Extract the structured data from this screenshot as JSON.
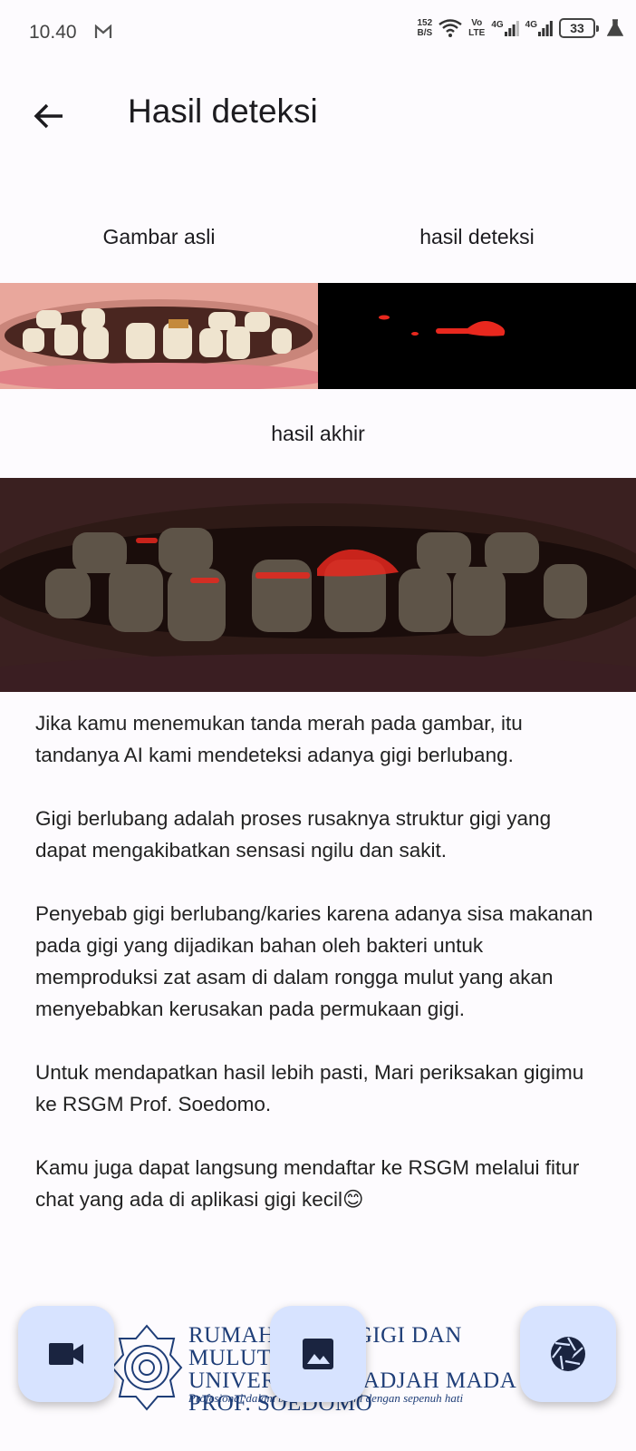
{
  "status": {
    "time": "10.40",
    "net_speed_value": "152",
    "net_speed_unit": "B/S",
    "volte_top": "Vo",
    "volte_bottom": "LTE",
    "sig1_label": "4G",
    "sig2_label": "4G",
    "battery": "33"
  },
  "appbar": {
    "title": "Hasil deteksi"
  },
  "images": {
    "original_label": "Gambar asli",
    "detection_label": "hasil deteksi",
    "final_label": "hasil akhir"
  },
  "content": {
    "paragraphs": [
      "Jika kamu menemukan tanda merah pada gambar, itu tandanya AI kami mendeteksi adanya gigi berlubang.",
      "Gigi berlubang adalah proses rusaknya struktur gigi yang dapat mengakibatkan sensasi ngilu dan sakit.",
      "Penyebab gigi berlubang/karies karena adanya sisa makanan pada gigi yang dijadikan bahan oleh bakteri untuk memproduksi zat asam di dalam rongga mulut yang akan menyebabkan kerusakan pada permukaan gigi.",
      "Untuk mendapatkan hasil lebih pasti, Mari periksakan gigimu ke RSGM Prof. Soedomo.",
      "Kamu juga dapat langsung mendaftar ke RSGM melalui fitur chat yang ada di aplikasi gigi kecil😊"
    ]
  },
  "logo": {
    "line1": "RUMAH SAKIT GIGI DAN MULUT",
    "line2": "UNIVERSITAS GADJAH MADA",
    "line3": "PROF. SOEDOMO",
    "tagline": "Profesional dalam bekerja, melayani dengan sepenuh hati"
  },
  "colors": {
    "fab_bg": "#d7e3ff",
    "icon": "#1a2440",
    "logo": "#1f3e78",
    "detection_red": "#e8281e"
  },
  "icons": {
    "back": "arrow-left-icon",
    "video": "videocam-icon",
    "gallery": "image-icon",
    "camera": "camera-shutter-icon"
  }
}
